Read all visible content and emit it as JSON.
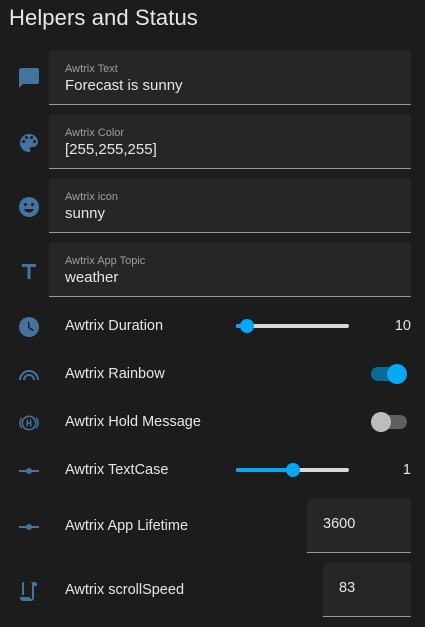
{
  "header": {
    "title": "Helpers and Status"
  },
  "text_fields": [
    {
      "label": "Awtrix Text",
      "value": "Forecast is sunny",
      "icon": "message-icon"
    },
    {
      "label": "Awtrix Color",
      "value": "[255,255,255]",
      "icon": "palette-icon"
    },
    {
      "label": "Awtrix icon",
      "value": "sunny",
      "icon": "smiley-icon"
    },
    {
      "label": "Awtrix App Topic",
      "value": "weather",
      "icon": "text-icon"
    }
  ],
  "duration": {
    "label": "Awtrix Duration",
    "value": "10",
    "level": 0.1,
    "icon": "clock-icon"
  },
  "rainbow": {
    "label": "Awtrix Rainbow",
    "on": true,
    "icon": "rainbow-icon"
  },
  "hold_message": {
    "label": "Awtrix Hold Message",
    "on": false,
    "icon": "hold-h-icon"
  },
  "textcase": {
    "label": "Awtrix TextCase",
    "value": "1",
    "level": 0.5,
    "icon": "slider-icon"
  },
  "app_lifetime": {
    "label": "Awtrix App Lifetime",
    "value": "3600",
    "icon": "slider-icon"
  },
  "scroll_speed": {
    "label": "Awtrix scrollSpeed",
    "value": "83",
    "icon": "script-icon"
  },
  "colors": {
    "accent": "#03a9f4",
    "icon": "#44739e",
    "background": "#1c1c1c",
    "field": "#262626"
  }
}
